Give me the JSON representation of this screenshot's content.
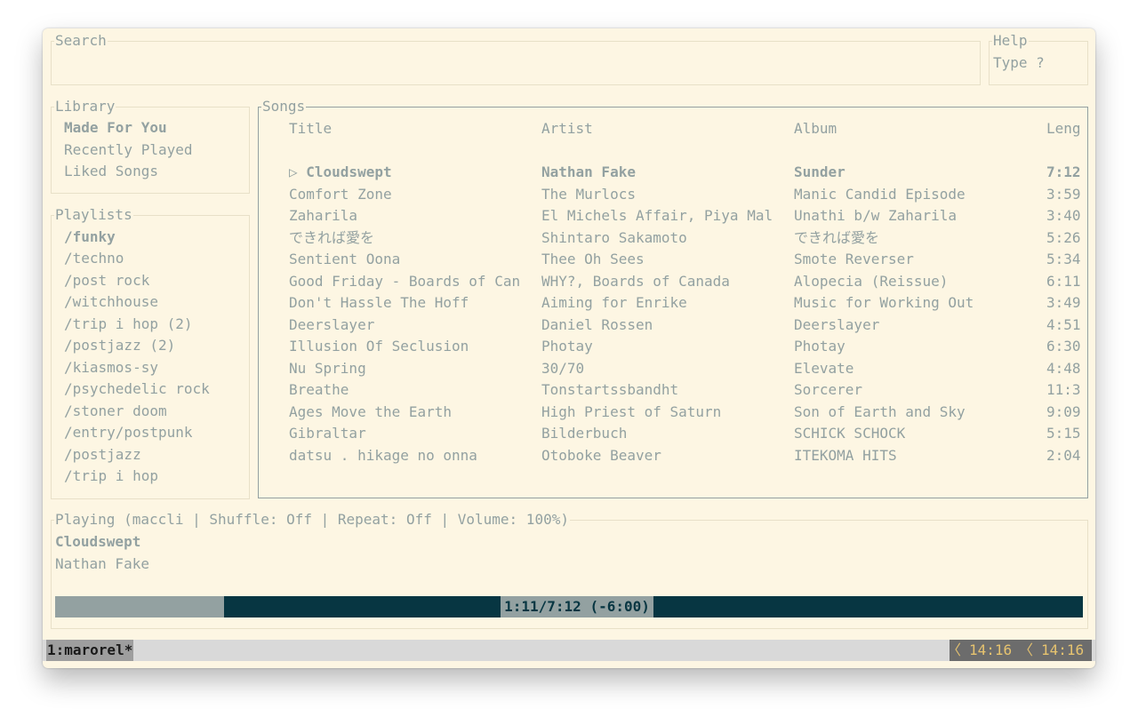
{
  "search": {
    "title": "Search",
    "value": ""
  },
  "help": {
    "title": "Help",
    "text": "Type ?"
  },
  "library": {
    "title": "Library",
    "items": [
      {
        "label": "Made For You"
      },
      {
        "label": "Recently Played"
      },
      {
        "label": "Liked Songs"
      }
    ]
  },
  "playlists": {
    "title": "Playlists",
    "items": [
      {
        "label": "/funky"
      },
      {
        "label": "/techno"
      },
      {
        "label": "/post rock"
      },
      {
        "label": "/witchhouse"
      },
      {
        "label": "/trip i hop (2)"
      },
      {
        "label": "/postjazz (2)"
      },
      {
        "label": "/kiasmos-sy"
      },
      {
        "label": "/psychedelic rock"
      },
      {
        "label": "/stoner doom"
      },
      {
        "label": "/entry/postpunk"
      },
      {
        "label": "/postjazz"
      },
      {
        "label": "/trip i hop"
      }
    ]
  },
  "songs": {
    "title": "Songs",
    "columns": {
      "title": "Title",
      "artist": "Artist",
      "album": "Album",
      "length": "Leng"
    },
    "rows": [
      {
        "title": "▷ Cloudswept",
        "artist": "Nathan Fake",
        "album": "Sunder",
        "length": "7:12"
      },
      {
        "title": "Comfort Zone",
        "artist": "The Murlocs",
        "album": "Manic Candid Episode",
        "length": "3:59"
      },
      {
        "title": "Zaharila",
        "artist": "El Michels Affair, Piya Mal",
        "album": "Unathi b/w Zaharila",
        "length": "3:40"
      },
      {
        "title": "できれば愛を",
        "artist": "Shintaro Sakamoto",
        "album": "できれば愛を",
        "length": "5:26"
      },
      {
        "title": "Sentient Oona",
        "artist": "Thee Oh Sees",
        "album": "Smote Reverser",
        "length": "5:34"
      },
      {
        "title": "Good Friday - Boards of Can",
        "artist": "WHY?, Boards of Canada",
        "album": "Alopecia (Reissue)",
        "length": "6:11"
      },
      {
        "title": "Don't Hassle The Hoff",
        "artist": "Aiming for Enrike",
        "album": "Music for Working Out",
        "length": "3:49"
      },
      {
        "title": "Deerslayer",
        "artist": "Daniel Rossen",
        "album": "Deerslayer",
        "length": "4:51"
      },
      {
        "title": "Illusion Of Seclusion",
        "artist": "Photay",
        "album": "Photay",
        "length": "6:30"
      },
      {
        "title": "Nu Spring",
        "artist": "30/70",
        "album": "Elevate",
        "length": "4:48"
      },
      {
        "title": "Breathe",
        "artist": "Tonstartssbandht",
        "album": "Sorcerer",
        "length": "11:3"
      },
      {
        "title": "Ages Move the Earth",
        "artist": "High Priest of Saturn",
        "album": "Son of Earth and Sky",
        "length": "9:09"
      },
      {
        "title": "Gibraltar",
        "artist": "Bilderbuch",
        "album": "SCHICK SCHOCK",
        "length": "5:15"
      },
      {
        "title": "datsu . hikage no onna",
        "artist": "Otoboke Beaver",
        "album": "ITEKOMA HITS",
        "length": "2:04"
      }
    ]
  },
  "player": {
    "status": "Playing (maccli | Shuffle: Off | Repeat: Off   | Volume: 100%)",
    "track": "Cloudswept",
    "artist": "Nathan Fake",
    "progress_text": "1:11/7:12 (-6:00)",
    "progress_fraction": 0.164
  },
  "tmux": {
    "window": "1:marorel*",
    "time1": "14:16",
    "time2": "14:16",
    "separator": "〈"
  },
  "colors": {
    "background": "#fdf6e3",
    "text": "#93a1a1",
    "progress_track": "#073642",
    "progress_fill": "#93a1a1",
    "clock": "#e6c36f"
  }
}
